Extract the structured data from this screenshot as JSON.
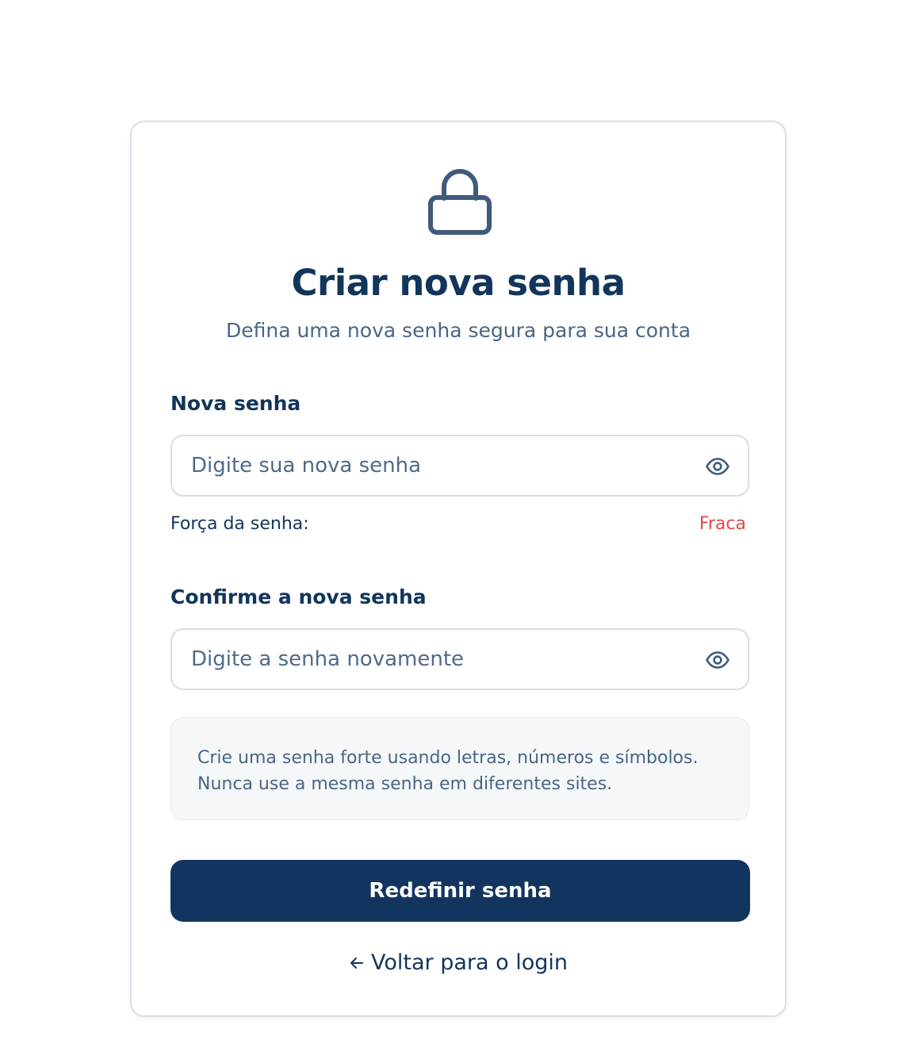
{
  "header": {
    "icon": "lock-icon",
    "title": "Criar nova senha",
    "subtitle": "Defina uma nova senha segura para sua conta"
  },
  "new_password": {
    "label": "Nova senha",
    "value": "",
    "placeholder": "Digite sua nova senha",
    "toggle_icon": "eye-icon"
  },
  "strength": {
    "label": "Força da senha:",
    "value": "Fraca",
    "color": "#e04848"
  },
  "confirm_password": {
    "label": "Confirme a nova senha",
    "value": "",
    "placeholder": "Digite a senha novamente",
    "toggle_icon": "eye-icon"
  },
  "tip": {
    "lines": [
      "Crie uma senha forte usando letras, números e símbolos.",
      "Nunca use a mesma senha em diferentes sites."
    ]
  },
  "actions": {
    "submit_label": "Redefinir senha",
    "back_label": "Voltar para o login",
    "back_icon": "arrow-left-icon"
  },
  "colors": {
    "primary": "#12355f",
    "text": "#12355b",
    "muted": "#4a6585",
    "border": "#d7dee6",
    "danger": "#e04848",
    "tip_background": "#f5f7f9"
  }
}
